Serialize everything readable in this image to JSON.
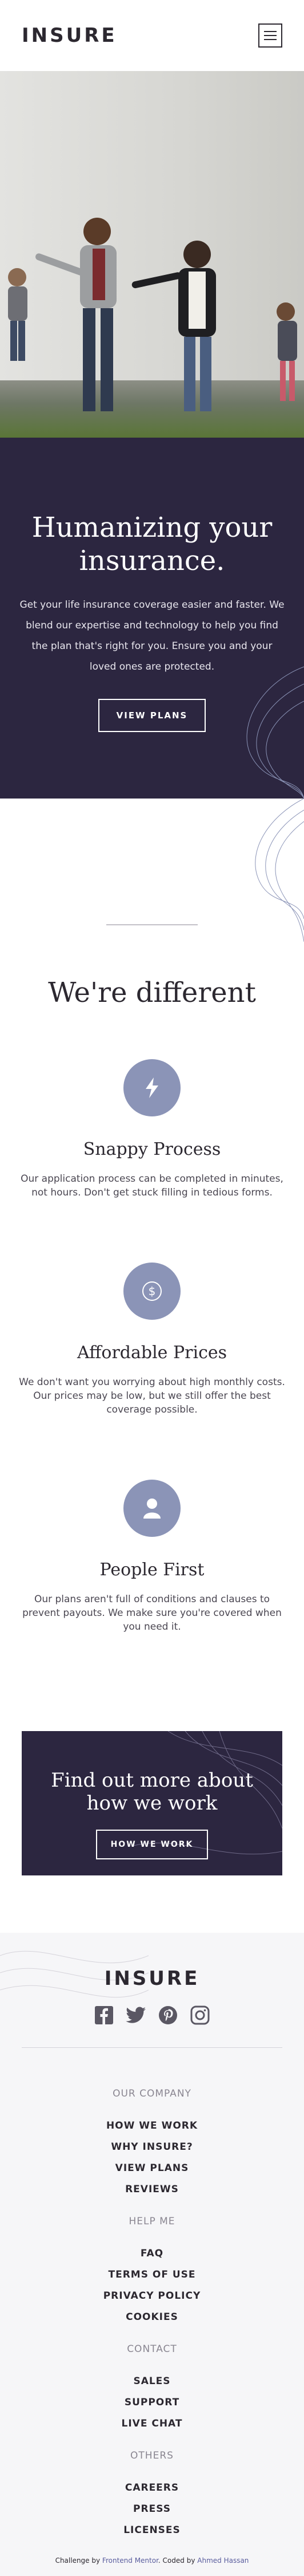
{
  "header": {
    "logo": "INSURE",
    "menu_icon": "hamburger-icon"
  },
  "hero": {
    "title": "Humanizing your insurance.",
    "description": "Get your life insurance coverage easier and faster. We blend our expertise and technology to help you find the plan that's right for you. Ensure you and your loved ones are protected.",
    "button": "VIEW PLANS"
  },
  "different": {
    "title": "We're different",
    "features": [
      {
        "icon": "lightning-icon",
        "title": "Snappy Process",
        "text": "Our application process can be completed in minutes, not hours. Don't get stuck filling in tedious forms."
      },
      {
        "icon": "dollar-icon",
        "title": "Affordable Prices",
        "text": "We don't want you worrying about high monthly costs. Our prices may be low, but we still offer the best coverage possible."
      },
      {
        "icon": "person-icon",
        "title": "People First",
        "text": "Our plans aren't full of conditions and clauses to prevent payouts. We make sure you're covered when you need it."
      }
    ]
  },
  "cta": {
    "title": "Find out more about how we work",
    "button": "HOW WE WORK"
  },
  "footer": {
    "logo": "INSURE",
    "socials": [
      "facebook-icon",
      "twitter-icon",
      "pinterest-icon",
      "instagram-icon"
    ],
    "groups": [
      {
        "heading": "OUR COMPANY",
        "links": [
          "HOW WE WORK",
          "WHY INSURE?",
          "VIEW PLANS",
          "REVIEWS"
        ]
      },
      {
        "heading": "HELP ME",
        "links": [
          "FAQ",
          "TERMS OF USE",
          "PRIVACY POLICY",
          "COOKIES"
        ]
      },
      {
        "heading": "CONTACT",
        "links": [
          "SALES",
          "SUPPORT",
          "LIVE CHAT"
        ]
      },
      {
        "heading": "OTHERS",
        "links": [
          "CAREERS",
          "PRESS",
          "LICENSES"
        ]
      }
    ],
    "attribution": {
      "prefix": "Challenge by",
      "fm": "Frontend Mentor",
      "mid": ". Coded by",
      "author": "Ahmed Hassan"
    }
  },
  "colors": {
    "dark_violet": "#2c2640",
    "very_dark_grayish_violet": "#2c2830",
    "grayish_blue": "#8b94b7",
    "light_bg": "#f6f6f8"
  }
}
